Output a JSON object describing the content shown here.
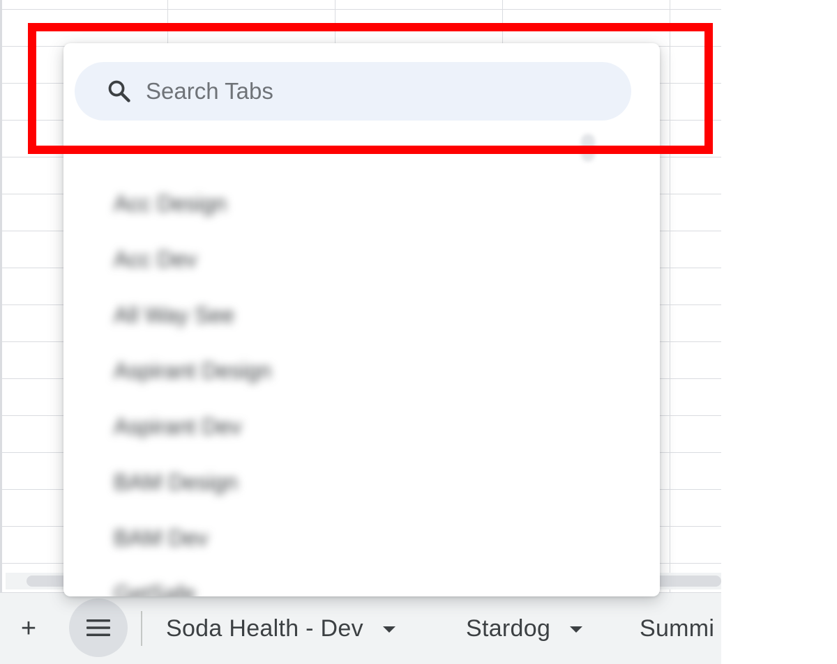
{
  "search": {
    "placeholder": "Search Tabs",
    "icon": "search-icon"
  },
  "sheet_list": {
    "items": [
      "Acc Design",
      "Acc Dev",
      "All Way See",
      "Aspirant Design",
      "Aspirant Dev",
      "BAM Design",
      "BAM Dev",
      "GetSafe"
    ]
  },
  "tabbar": {
    "add_icon": "+",
    "all_sheets_icon": "menu-icon",
    "tabs": [
      {
        "label": "Soda Health - Dev"
      },
      {
        "label": "Stardog"
      },
      {
        "label": "Summi"
      }
    ]
  },
  "colors": {
    "search_bg": "#edf2fa",
    "highlight": "#ff0000",
    "tabbar_bg": "#f1f3f4",
    "active_button_bg": "#dcdfe3"
  }
}
